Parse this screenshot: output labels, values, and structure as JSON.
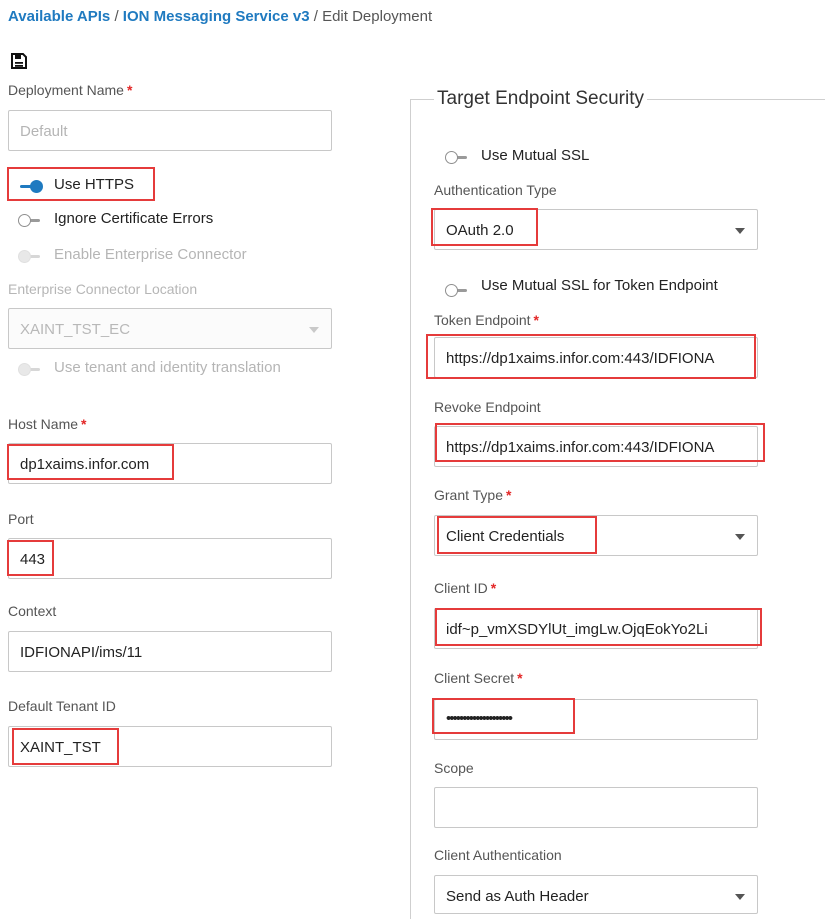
{
  "breadcrumb": {
    "item1": "Available APIs",
    "sep1": " / ",
    "item2": "ION Messaging Service v3",
    "sep2": " / ",
    "current": "Edit Deployment"
  },
  "toolbar": {
    "save_icon": "save-icon"
  },
  "required_mark": "*",
  "left": {
    "deployment_name": {
      "label": "Deployment Name",
      "value": "",
      "placeholder": "Default"
    },
    "use_https": {
      "label": "Use HTTPS",
      "on": true
    },
    "ignore_cert": {
      "label": "Ignore Certificate Errors",
      "on": false
    },
    "enterprise_connector": {
      "label": "Enable Enterprise Connector",
      "on": false
    },
    "ec_location": {
      "label": "Enterprise Connector Location",
      "value": "XAINT_TST_EC"
    },
    "tenant_translation": {
      "label": "Use tenant and identity translation",
      "on": false
    },
    "host_name": {
      "label": "Host Name",
      "value": "dp1xaims.infor.com"
    },
    "port": {
      "label": "Port",
      "value": "443"
    },
    "context": {
      "label": "Context",
      "value": "IDFIONAPI/ims/11"
    },
    "tenant_id": {
      "label": "Default Tenant ID",
      "value": "XAINT_TST"
    }
  },
  "security": {
    "legend": "Target Endpoint Security",
    "mutual_ssl": {
      "label": "Use Mutual SSL",
      "on": false
    },
    "auth_type": {
      "label": "Authentication Type",
      "value": "OAuth 2.0"
    },
    "mutual_ssl_token": {
      "label": "Use Mutual SSL for Token Endpoint",
      "on": false
    },
    "token_endpoint": {
      "label": "Token Endpoint",
      "value": "https://dp1xaims.infor.com:443/IDFIONA"
    },
    "revoke_endpoint": {
      "label": "Revoke Endpoint",
      "value": "https://dp1xaims.infor.com:443/IDFIONA"
    },
    "grant_type": {
      "label": "Grant Type",
      "value": "Client Credentials"
    },
    "client_id": {
      "label": "Client ID",
      "value": "idf~p_vmXSDYlUt_imgLw.OjqEokYo2Li"
    },
    "client_secret": {
      "label": "Client Secret",
      "value": "••••••••••••••••••••"
    },
    "scope": {
      "label": "Scope",
      "value": ""
    },
    "client_auth": {
      "label": "Client Authentication",
      "value": "Send as Auth Header"
    }
  },
  "colors": {
    "link": "#1f7ac0",
    "highlight": "#e53b3b",
    "required": "#e32727"
  }
}
